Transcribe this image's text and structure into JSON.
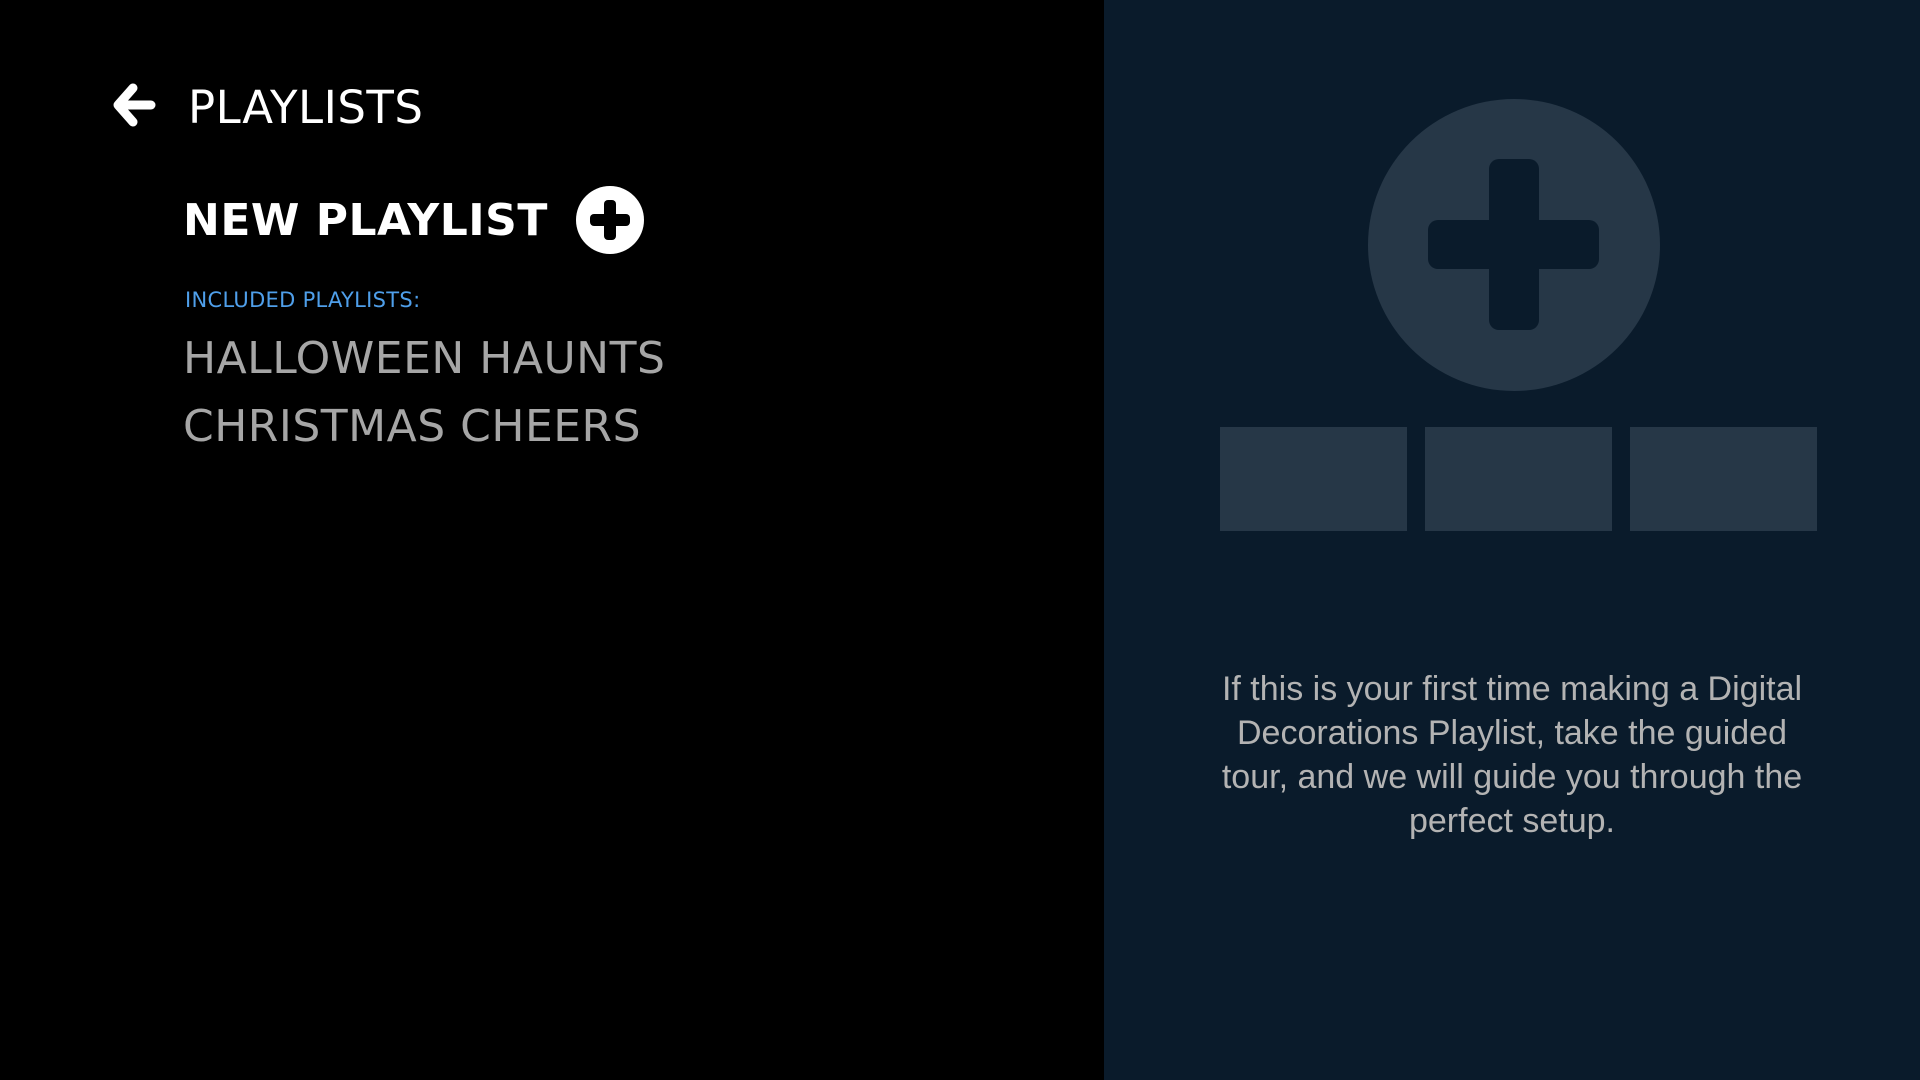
{
  "header": {
    "back_icon": "arrow-left-icon",
    "title": "PLAYLISTS"
  },
  "new_playlist": {
    "label": "NEW PLAYLIST",
    "icon": "plus-circle-icon"
  },
  "included": {
    "label": "INCLUDED PLAYLISTS:",
    "items": [
      {
        "label": "HALLOWEEN HAUNTS"
      },
      {
        "label": "CHRISTMAS CHEERS"
      }
    ]
  },
  "tour_panel": {
    "illustration_icon": "plus-circle-icon",
    "message": "If this is your first time making a Digital Decorations Playlist, take the guided tour, and we will guide you through the perfect setup."
  },
  "colors": {
    "left_background": "#000000",
    "right_background": "#0a1b2b",
    "accent_label": "#4f9fea",
    "muted_item_text": "#a6a6a6",
    "illustration_fill": "#263747"
  }
}
